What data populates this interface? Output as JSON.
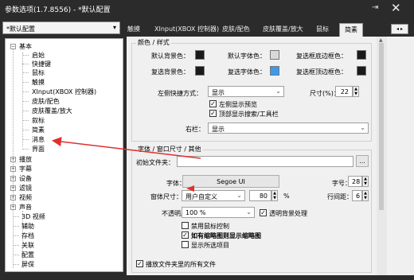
{
  "window": {
    "title": "参数选项(1.7.8556) - *默认配置"
  },
  "preset": {
    "value": "*默认配置"
  },
  "tabs": [
    {
      "label": "触摸"
    },
    {
      "label": "XInput(XBOX 控制器)"
    },
    {
      "label": "皮肤/配色"
    },
    {
      "label": "皮肤覆盖/放大"
    },
    {
      "label": "鼠标"
    },
    {
      "label": "简素"
    }
  ],
  "tree": {
    "items": [
      {
        "label": "基本"
      },
      {
        "label": "启始"
      },
      {
        "label": "快捷键"
      },
      {
        "label": "鼠标"
      },
      {
        "label": "触摸"
      },
      {
        "label": "XInput(XBOX 控制器)"
      },
      {
        "label": "皮肤/配色"
      },
      {
        "label": "皮肤覆盖/放大"
      },
      {
        "label": "叙标"
      },
      {
        "label": "简素"
      },
      {
        "label": "消息"
      },
      {
        "label": "界面"
      },
      {
        "label": "播放"
      },
      {
        "label": "字幕"
      },
      {
        "label": "设备"
      },
      {
        "label": "滤镜"
      },
      {
        "label": "视频"
      },
      {
        "label": "声音"
      },
      {
        "label": "3D 视频"
      },
      {
        "label": "辅助"
      },
      {
        "label": "存档"
      },
      {
        "label": "关联"
      },
      {
        "label": "配置"
      },
      {
        "label": "屏保"
      }
    ]
  },
  "colors_group": {
    "title": "颜色 / 样式",
    "default_bg": "默认背景色：",
    "default_font": "默认字体色：",
    "check_bottom": "复选框底边框色：",
    "check_bg": "复选背景色：",
    "check_font": "复选字体色：",
    "check_top": "复选框顶边框色："
  },
  "swatches": {
    "dark": "#1a1a1a",
    "light": "#d9d9d9",
    "blue": "#3d9ae8"
  },
  "left_shortcut": {
    "label": "左侧快捷方式：",
    "value": "显示",
    "size_label": "尺寸(%)：",
    "size_value": "22"
  },
  "checks1": {
    "preview": "左侧显示预览",
    "top_search": "顶部显示搜索/工具栏"
  },
  "right_bar": {
    "label": "右栏：",
    "value": "显示"
  },
  "font_group": {
    "title": "字体 / 窗口尺寸 / 其他",
    "init_folder": "初始文件夹：",
    "browse": "...",
    "font_label": "字体：",
    "font_value": "Segoe UI",
    "size_label": "字号：",
    "size_value": "28",
    "win_size_label": "窗体尺寸：",
    "win_size_value": "用户自定义",
    "percent_value": "80",
    "percent_unit": "%",
    "line_spacing_label": "行间距：",
    "line_spacing_value": "6",
    "opacity_label": "不透明度：",
    "opacity_value": "100 %",
    "transparent_bg": "透明背景处理",
    "disable_mouse": "禁用鼠标控制",
    "thumbnail": "如有缩略图则显示缩略图",
    "show_selected": "显示所选项目",
    "play_all": "播放文件夹里的所有文件"
  }
}
